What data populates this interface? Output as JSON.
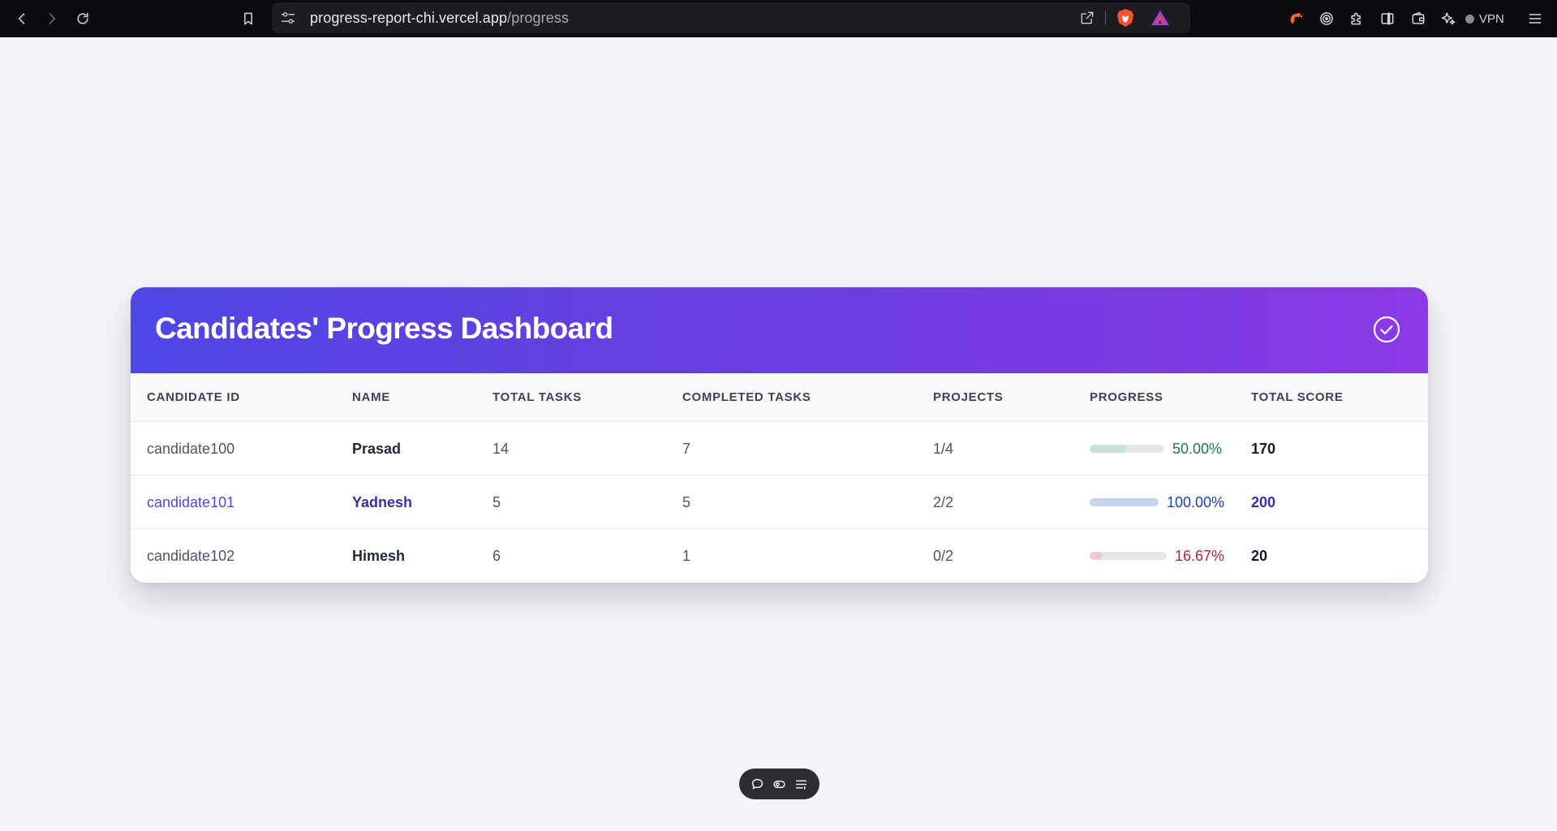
{
  "browser": {
    "url_host": "progress-report-chi.vercel.app",
    "url_path": "/progress",
    "vpn_label": "VPN",
    "icons": [
      "back-icon",
      "forward-icon",
      "reload-icon",
      "bookmark-icon",
      "site-settings-icon",
      "share-icon",
      "brave-shields-icon",
      "brave-rewards-icon",
      "leo-icon",
      "tor-icon",
      "extensions-icon",
      "sidebar-icon",
      "wallet-icon",
      "ai-icon",
      "menu-icon"
    ]
  },
  "dashboard": {
    "title": "Candidates' Progress Dashboard",
    "header_icon": "check-circle-icon",
    "columns": [
      "CANDIDATE ID",
      "NAME",
      "TOTAL TASKS",
      "COMPLETED TASKS",
      "PROJECTS",
      "PROGRESS",
      "TOTAL SCORE"
    ],
    "rows": [
      {
        "id": "candidate100",
        "name": "Prasad",
        "total_tasks": "14",
        "completed_tasks": "7",
        "projects": "1/4",
        "progress": 0.5,
        "progress_label": "50.00%",
        "progress_color": "#1f7a4a",
        "fill_color": "#c7e3d6",
        "score": "170",
        "highlighted": false
      },
      {
        "id": "candidate101",
        "name": "Yadnesh",
        "total_tasks": "5",
        "completed_tasks": "5",
        "projects": "2/2",
        "progress": 1.0,
        "progress_label": "100.00%",
        "progress_color": "#1e40af",
        "fill_color": "#c7d3ec",
        "score": "200",
        "highlighted": true
      },
      {
        "id": "candidate102",
        "name": "Himesh",
        "total_tasks": "6",
        "completed_tasks": "1",
        "projects": "0/2",
        "progress": 0.1667,
        "progress_label": "16.67%",
        "progress_color": "#b3213f",
        "fill_color": "#eec9d0",
        "score": "20",
        "highlighted": false
      }
    ]
  },
  "floating_toolbar": {
    "icons": [
      "comment-icon",
      "toggle-icon",
      "menu-lines-icon"
    ]
  },
  "colors": {
    "header_gradient_start": "#4f46e5",
    "header_gradient_end": "#8b3ae6",
    "page_background": "#f4f5f8"
  }
}
